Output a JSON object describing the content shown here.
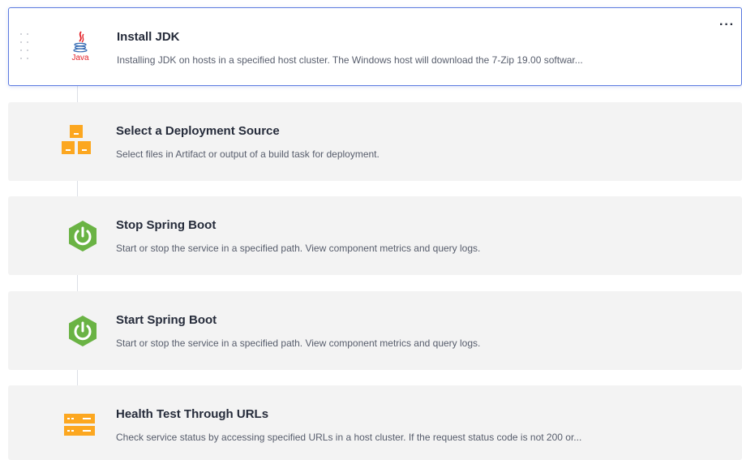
{
  "steps": [
    {
      "title": "Install JDK",
      "description": "Installing JDK on hosts in a specified host cluster. The Windows host will download the 7-Zip 19.00 softwar...",
      "icon": "java-icon",
      "icon_label": "Java",
      "selected": true
    },
    {
      "title": "Select a Deployment Source",
      "description": "Select files in Artifact or output of a build task for deployment.",
      "icon": "deployment-source-boxes-icon"
    },
    {
      "title": "Stop Spring Boot",
      "description": "Start or stop the service in a specified path. View component metrics and query logs.",
      "icon": "spring-boot-power-icon"
    },
    {
      "title": "Start Spring Boot",
      "description": "Start or stop the service in a specified path. View component metrics and query logs.",
      "icon": "spring-boot-power-icon"
    },
    {
      "title": "Health Test Through URLs",
      "description": "Check service status by accessing specified URLs in a host cluster. If the request status code is not 200 or...",
      "icon": "server-health-icon"
    }
  ],
  "more_label": "···",
  "colors": {
    "selected_border": "#5e7ce0",
    "card_bg": "#f3f3f3",
    "orange": "#fca720",
    "spring_green": "#6ab344",
    "java_red": "#e32128",
    "java_blue": "#3a6fb5"
  }
}
